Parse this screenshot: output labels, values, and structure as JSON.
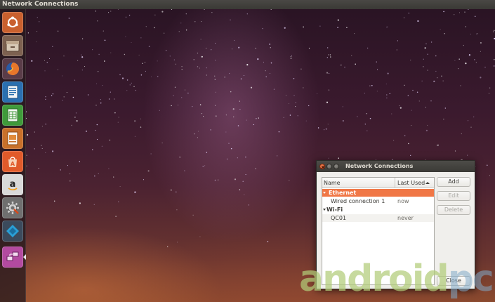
{
  "top_panel": {
    "title": "Network Connections"
  },
  "launcher": {
    "items": [
      {
        "name": "ubuntu-dash",
        "icon": "ubuntu-logo-icon",
        "color": "#c9602e"
      },
      {
        "name": "files",
        "icon": "file-cabinet-icon",
        "color": "#8a6a4e"
      },
      {
        "name": "firefox",
        "icon": "firefox-icon",
        "color": "#e0702a"
      },
      {
        "name": "libreoffice-writer",
        "icon": "writer-document-icon",
        "color": "#2a6fb0"
      },
      {
        "name": "libreoffice-calc",
        "icon": "calc-spreadsheet-icon",
        "color": "#3f9a3a"
      },
      {
        "name": "libreoffice-impress",
        "icon": "impress-presentation-icon",
        "color": "#c8702a"
      },
      {
        "name": "ubuntu-software",
        "icon": "shopping-bag-icon",
        "color": "#e05a2a"
      },
      {
        "name": "amazon",
        "icon": "amazon-icon",
        "color": "#d9d9d9"
      },
      {
        "name": "system-settings",
        "icon": "gear-wrench-icon",
        "color": "#8c8c8c"
      },
      {
        "name": "kodi",
        "icon": "kodi-icon",
        "color": "#2a8fc0"
      },
      {
        "name": "network-connections",
        "icon": "network-icon",
        "color": "#b34aa0"
      }
    ]
  },
  "dialog": {
    "title": "Network Connections",
    "columns": {
      "name": "Name",
      "last_used": "Last Used"
    },
    "rows": [
      {
        "type": "group",
        "label": "Ethernet",
        "selected": true
      },
      {
        "type": "connection",
        "label": "Wired connection 1",
        "last_used": "now"
      },
      {
        "type": "group",
        "label": "Wi-Fi"
      },
      {
        "type": "connection",
        "label": "QC01",
        "last_used": "never"
      }
    ],
    "buttons": {
      "add": "Add",
      "edit": "Edit",
      "delete": "Delete",
      "close": "Close"
    },
    "colors": {
      "selection": "#f07746",
      "close_button": "#d8481a"
    }
  },
  "watermark": {
    "part1": "android",
    "part2": "pc"
  }
}
